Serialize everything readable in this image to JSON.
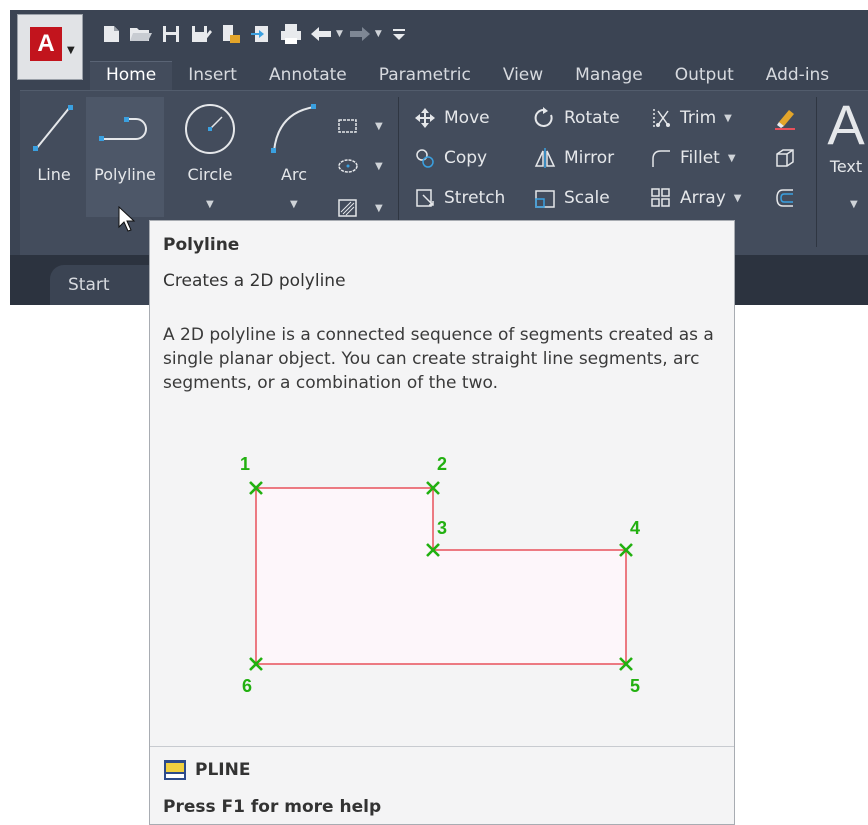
{
  "app": {
    "logo_letter": "A",
    "brand_color": "#c2141d"
  },
  "quick_access": {
    "icons": [
      "new-icon",
      "open-icon",
      "save-icon",
      "save-as-icon",
      "publish-icon",
      "export-icon",
      "plot-icon",
      "undo-icon",
      "redo-icon",
      "customize-icon"
    ]
  },
  "tabs": [
    {
      "label": "Home",
      "active": true
    },
    {
      "label": "Insert",
      "active": false
    },
    {
      "label": "Annotate",
      "active": false
    },
    {
      "label": "Parametric",
      "active": false
    },
    {
      "label": "View",
      "active": false
    },
    {
      "label": "Manage",
      "active": false
    },
    {
      "label": "Output",
      "active": false
    },
    {
      "label": "Add-ins",
      "active": false
    }
  ],
  "ribbon": {
    "draw": {
      "line": "Line",
      "polyline": "Polyline",
      "circle": "Circle",
      "arc": "Arc"
    },
    "modify": {
      "move": "Move",
      "rotate": "Rotate",
      "trim": "Trim",
      "copy": "Copy",
      "mirror": "Mirror",
      "fillet": "Fillet",
      "stretch": "Stretch",
      "scale": "Scale",
      "array": "Array"
    },
    "annotation": {
      "text": "Text",
      "big_letter": "A"
    }
  },
  "start_tab": "Start",
  "tooltip": {
    "title": "Polyline",
    "subtitle": "Creates a 2D polyline",
    "description": "A 2D polyline is a connected sequence of segments created as a single planar object. You can create straight line segments, arc segments, or a combination of the two.",
    "vertex_labels": [
      "1",
      "2",
      "3",
      "4",
      "5",
      "6"
    ],
    "command": "PLINE",
    "help": "Press F1 for more help",
    "colors": {
      "outline": "#e8505b",
      "vertex": "#22b010",
      "fill": "#fdf6fa"
    }
  }
}
